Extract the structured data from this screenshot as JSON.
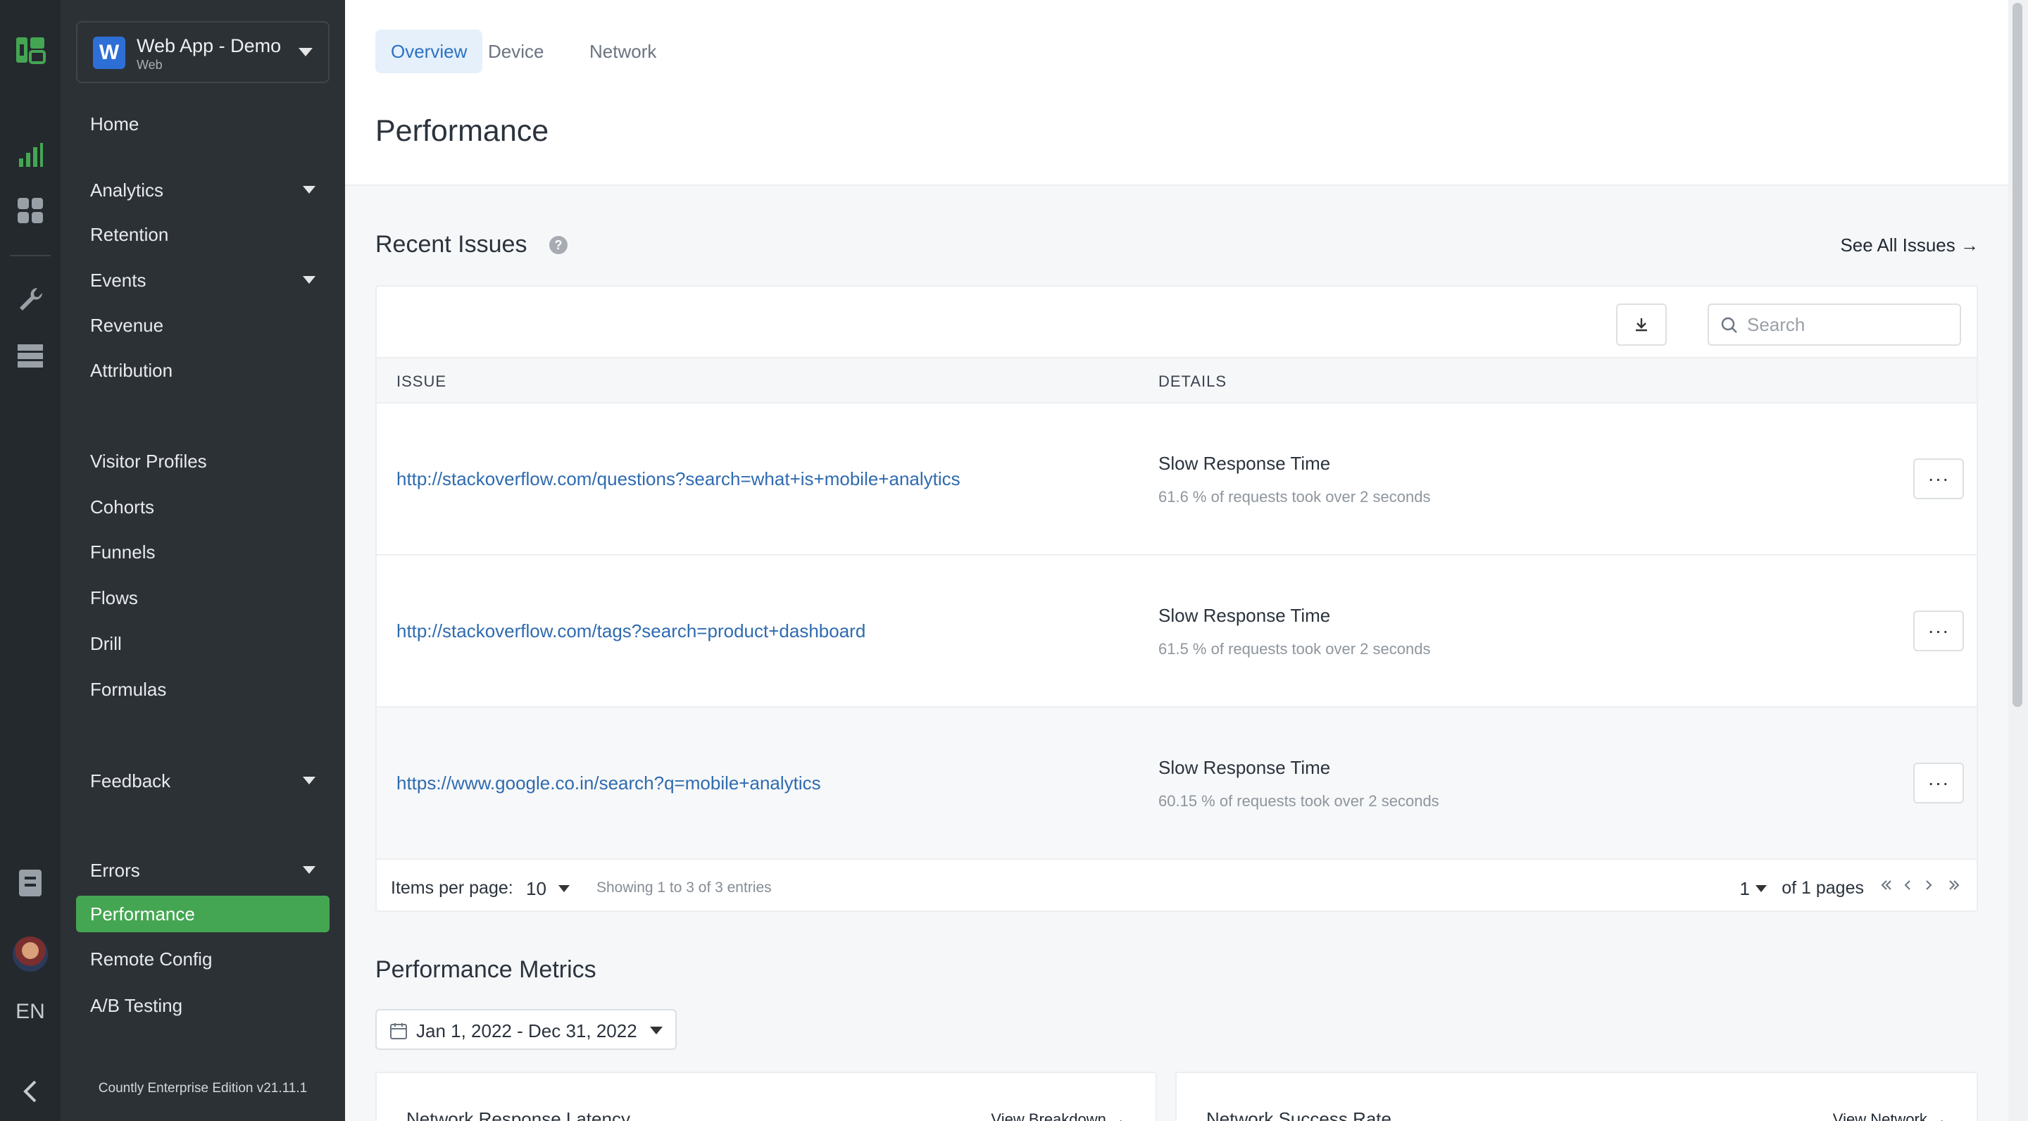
{
  "app": {
    "name": "Web App - Demo",
    "type": "Web",
    "badge": "W"
  },
  "rail": {
    "language": "EN",
    "icons": [
      "countly-logo-icon",
      "analytics-bars-icon",
      "dashboard-grid-icon",
      "wrench-icon",
      "database-icon",
      "clipboard-icon",
      "avatar",
      "chevron-left-icon"
    ]
  },
  "sidebar": {
    "items": [
      {
        "label": "Home"
      },
      {
        "label": "Analytics"
      },
      {
        "label": "Retention"
      },
      {
        "label": "Events"
      },
      {
        "label": "Revenue"
      },
      {
        "label": "Attribution"
      },
      {
        "label": "Visitor Profiles"
      },
      {
        "label": "Cohorts"
      },
      {
        "label": "Funnels"
      },
      {
        "label": "Flows"
      },
      {
        "label": "Drill"
      },
      {
        "label": "Formulas"
      },
      {
        "label": "Feedback"
      },
      {
        "label": "Errors"
      },
      {
        "label": "Performance"
      },
      {
        "label": "Remote Config"
      },
      {
        "label": "A/B Testing"
      }
    ],
    "version": "Countly Enterprise Edition v21.11.1"
  },
  "tabs": [
    {
      "label": "Overview"
    },
    {
      "label": "Device"
    },
    {
      "label": "Network"
    }
  ],
  "page_title": "Performance",
  "recent_issues": {
    "title": "Recent Issues",
    "help": "?",
    "see_all": "See All Issues →",
    "search_placeholder": "Search",
    "columns": {
      "issue": "ISSUE",
      "details": "DETAILS"
    },
    "rows": [
      {
        "url": "http://stackoverflow.com/questions?search=what+is+mobile+analytics",
        "title": "Slow Response Time",
        "sub": "61.6 % of requests took over 2 seconds"
      },
      {
        "url": "http://stackoverflow.com/tags?search=product+dashboard",
        "title": "Slow Response Time",
        "sub": "61.5 % of requests took over 2 seconds"
      },
      {
        "url": "https://www.google.co.in/search?q=mobile+analytics",
        "title": "Slow Response Time",
        "sub": "60.15 % of requests took over 2 seconds"
      }
    ],
    "more_label": "···",
    "pager": {
      "items_per_page_label": "Items per page:",
      "items_per_page": "10",
      "showing": "Showing 1 to 3 of 3 entries",
      "page": "1",
      "of_pages": "of 1 pages"
    }
  },
  "metrics": {
    "title": "Performance Metrics",
    "date_range": "Jan 1, 2022 - Dec 31, 2022",
    "cards": [
      {
        "title": "Network Response Latency",
        "link": "View Breakdown →"
      },
      {
        "title": "Network Success Rate",
        "link": "View Network →"
      }
    ]
  },
  "colors": {
    "accent_green": "#44a652",
    "link_blue": "#2f6bb0",
    "sidebar_bg": "#2c3136",
    "rail_bg": "#24292e"
  }
}
